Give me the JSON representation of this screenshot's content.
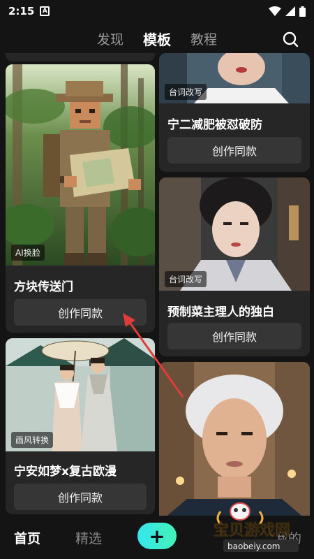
{
  "status": {
    "time": "2:15",
    "sim_label": "A"
  },
  "tabs": [
    {
      "label": "发现",
      "active": false
    },
    {
      "label": "模板",
      "active": true
    },
    {
      "label": "教程",
      "active": false
    }
  ],
  "cards": {
    "left1": {
      "badge": "AI换脸",
      "title": "方块传送门",
      "button": "创作同款"
    },
    "left2": {
      "badge": "画风转换",
      "title": "宁安如梦x复古欧漫",
      "button": "创作同款"
    },
    "right1": {
      "badge": "台词改写",
      "title": "宁二减肥被怼破防",
      "button": "创作同款"
    },
    "right2": {
      "badge": "台词改写",
      "title": "预制菜主理人的独白",
      "button": "创作同款"
    }
  },
  "bottom_nav": {
    "home": "首页",
    "featured": "精选",
    "plus": "+",
    "mine": "我的"
  },
  "watermark": {
    "title": "宝贝游戏网",
    "url": "baobeiy.com"
  },
  "colors": {
    "accent_start": "#35e6f0",
    "accent_end": "#43f2b6",
    "arrow": "#e03c3c",
    "bg": "#141414",
    "card": "#262626"
  }
}
